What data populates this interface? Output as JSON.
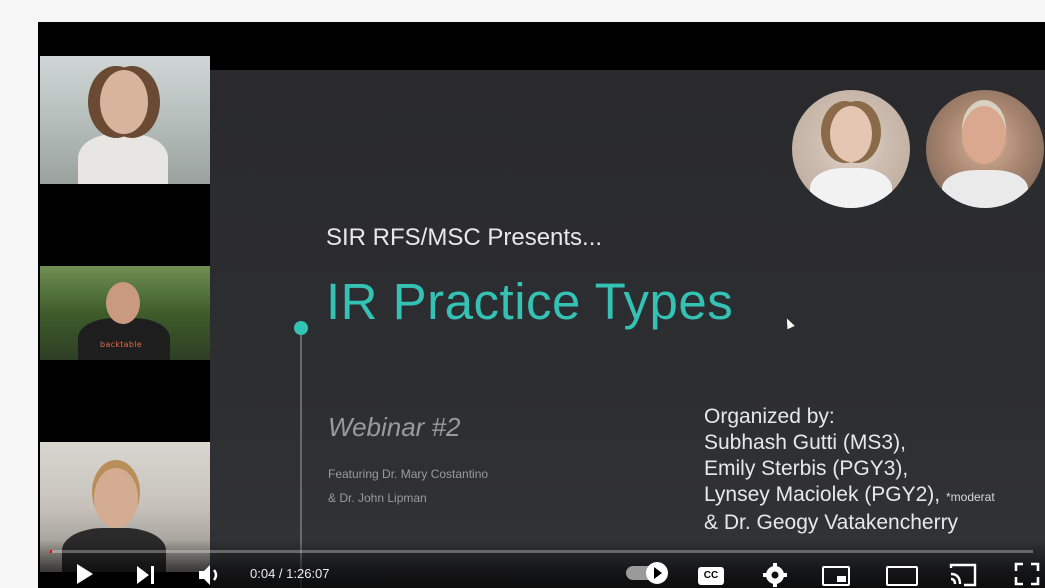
{
  "slide": {
    "presents": "SIR RFS/MSC Presents...",
    "title": "IR Practice Types",
    "webinar": "Webinar #2",
    "featuring_line1": "Featuring Dr. Mary Costantino",
    "featuring_line2": "& Dr. John Lipman",
    "organized_by": "Organized by:",
    "organizers": [
      "Subhash Gutti (MS3),",
      "Emily Sterbis (PGY3),",
      "Lynsey Maciolek (PGY2),",
      "& Dr. Geogy Vatakencherry"
    ],
    "moderator_note": "*moderat"
  },
  "webcam": {
    "shirt_text": "backtable"
  },
  "player": {
    "time": "0:04 / 1:26:07",
    "progress": 0.0008,
    "cc_label": "CC",
    "icons": {
      "play": "play-icon",
      "next": "next-icon",
      "volume": "volume-icon",
      "autoplay": "autoplay-toggle",
      "settings": "gear-icon",
      "miniplayer": "miniplayer-icon",
      "theater": "theater-icon",
      "cast": "cast-icon",
      "fullscreen": "fullscreen-icon"
    }
  }
}
